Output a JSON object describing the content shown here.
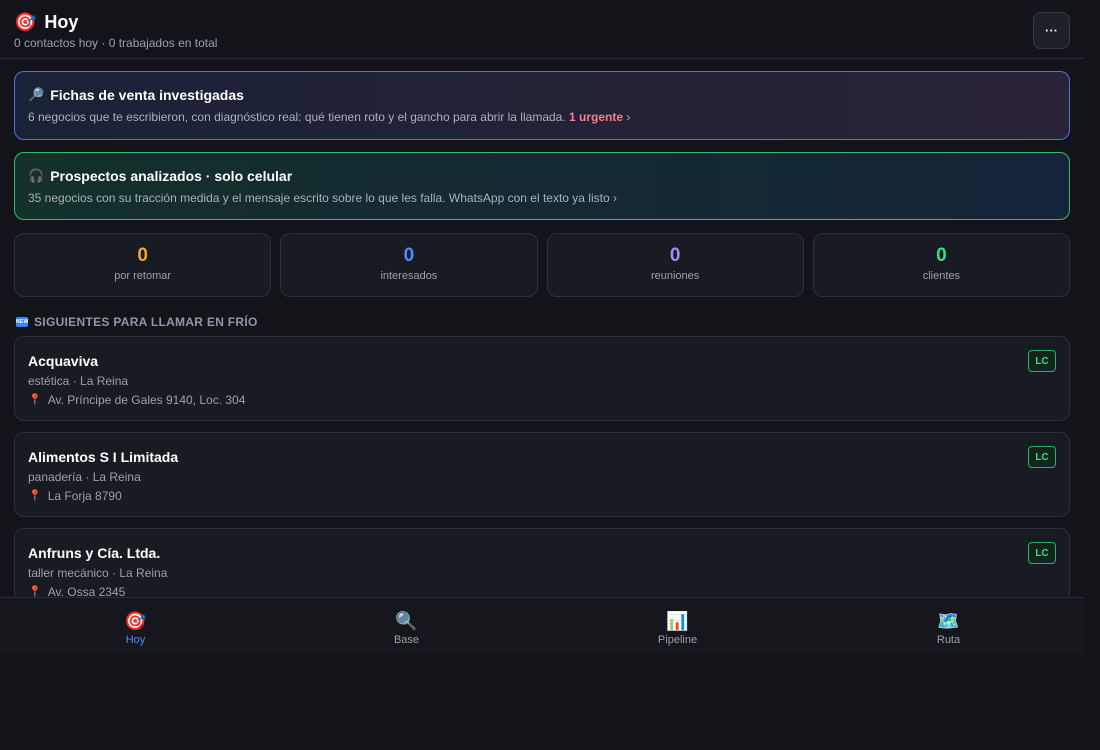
{
  "header": {
    "emoji": "🎯",
    "title": "Hoy",
    "subtitle": "0 contactos hoy · 0 trabajados en total",
    "menu_label": "···"
  },
  "banners": [
    {
      "icon": "🔎",
      "title": "Fichas de venta investigadas",
      "desc": "6 negocios que te escribieron, con diagnóstico real: qué tienen roto y el gancho para abrir la llamada.",
      "urgent": "1 urgente",
      "chevron": "›"
    },
    {
      "icon": "🎧",
      "title": "Prospectos analizados · solo celular",
      "desc": "35 negocios con su tracción medida y el mensaje escrito sobre lo que les falla. WhatsApp con el texto ya listo",
      "chevron": "›"
    }
  ],
  "stats": [
    {
      "value": "0",
      "label": "por retomar",
      "color": "#f5a524"
    },
    {
      "value": "0",
      "label": "interesados",
      "color": "#4f8cff"
    },
    {
      "value": "0",
      "label": "reuniones",
      "color": "#a78bfa"
    },
    {
      "value": "0",
      "label": "clientes",
      "color": "#3ddc84"
    }
  ],
  "section": {
    "badge": "NEW",
    "title": "SIGUIENTES PARA LLAMAR EN FRÍO"
  },
  "prospects": [
    {
      "name": "Acquaviva",
      "meta": "estética · La Reina",
      "address": "Av. Príncipe de Gales 9140, Loc. 304",
      "badge": "LC"
    },
    {
      "name": "Alimentos S I Limitada",
      "meta": "panadería · La Reina",
      "address": "La Forja 8790",
      "badge": "LC"
    },
    {
      "name": "Anfruns y Cía. Ltda.",
      "meta": "taller mecánico · La Reina",
      "address": "Av. Ossa 2345",
      "badge": "LC"
    }
  ],
  "nav": [
    {
      "icon": "🎯",
      "label": "Hoy",
      "active": true
    },
    {
      "icon": "🔍",
      "label": "Base",
      "active": false
    },
    {
      "icon": "📊",
      "label": "Pipeline",
      "active": false
    },
    {
      "icon": "🗺️",
      "label": "Ruta",
      "active": false
    }
  ]
}
